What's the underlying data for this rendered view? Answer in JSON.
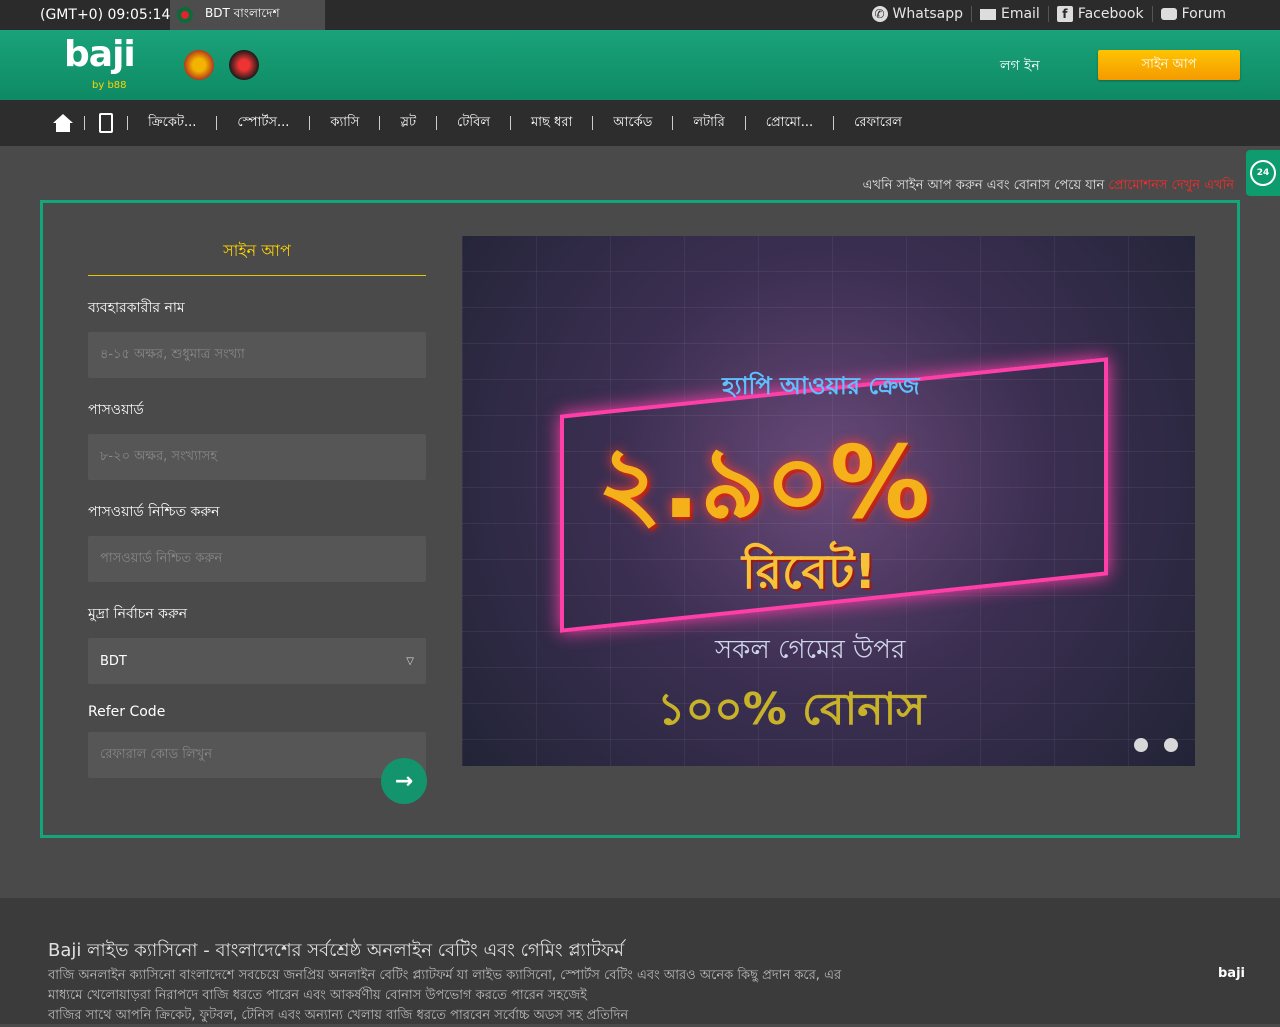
{
  "topbar": {
    "clock": "(GMT+0) 09:05:14",
    "currency": "BDT বাংলাদেশ",
    "social": [
      {
        "label": "Whatsapp",
        "icon": "whatsapp-icon"
      },
      {
        "label": "Email",
        "icon": "email-icon"
      },
      {
        "label": "Facebook",
        "icon": "facebook-icon"
      },
      {
        "label": "Forum",
        "icon": "forum-icon"
      }
    ]
  },
  "header": {
    "logo": "baji",
    "logo_sub": "by b88",
    "login": "লগ ইন",
    "signup": "সাইন আপ"
  },
  "nav": {
    "items": [
      "ক্রিকেট...",
      "স্পোর্টস...",
      "ক্যাসি",
      "স্লট",
      "টেবিল",
      "মাছ ধরা",
      "আর্কেড",
      "লটারি",
      "প্রোমো...",
      "রেফারেল"
    ]
  },
  "notice": {
    "text": "এখনি সাইন আপ করুন এবং বোনাস পেয়ে যান",
    "link": "প্রোমোশনস দেখুন এখনি"
  },
  "form": {
    "title": "সাইন আপ",
    "username_label": "ব্যবহারকারীর নাম",
    "username_placeholder": "৪-১৫ অক্ষর, শুধুমাত্র সংখ্যা",
    "password_label": "পাসওয়ার্ড",
    "password_placeholder": "৮-২০ অক্ষর, সংখ্যাসহ",
    "confirm_label": "পাসওয়ার্ড নিশ্চিত করুন",
    "confirm_placeholder": "পাসওয়ার্ড নিশ্চিত করুন",
    "currency_label": "মুদ্রা নির্বাচন করুন",
    "currency_value": "BDT",
    "refer_label": "Refer Code",
    "refer_placeholder": "রেফারাল কোড লিখুন"
  },
  "banner": {
    "headline": "হ্যাপি আওয়ার ক্রেজ",
    "big": "২.৯০%",
    "rebate": "রিবেট!",
    "line": "সকল গেমের উপর",
    "bonus": "১০০% বোনাস"
  },
  "footer": {
    "title": "Baji লাইভ ক্যাসিনো - বাংলাদেশের সর্বশ্রেষ্ঠ অনলাইন বেটিং এবং গেমিং প্ল্যাটফর্ম",
    "p1": "বাজি অনলাইন ক্যাসিনো বাংলাদেশে সবচেয়ে জনপ্রিয় অনলাইন বেটিং প্ল্যাটফর্ম যা লাইভ ক্যাসিনো, স্পোর্টস বেটিং এবং আরও অনেক কিছু প্রদান করে, এর",
    "p2": "মাধ্যমে খেলোয়াড়রা নিরাপদে বাজি ধরতে পারেন এবং আকর্ষণীয় বোনাস উপভোগ করতে পারেন সহজেই",
    "p3": "বাজির সাথে আপনি ক্রিকেট, ফুটবল, টেনিস এবং অন্যান্য খেলায় বাজি ধরতে পারবেন সর্বোচ্চ অডস সহ প্রতিদিন",
    "logo": "baji"
  }
}
